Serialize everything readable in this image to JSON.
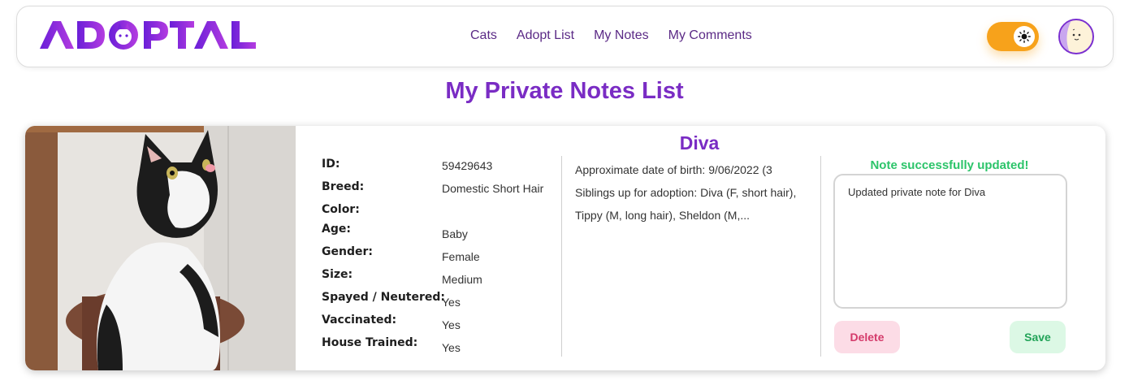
{
  "header": {
    "logo_text": "ADOPTAL",
    "nav": [
      "Cats",
      "Adopt List",
      "My Notes",
      "My Comments"
    ],
    "theme_toggle_icon": "sun-icon",
    "avatar_icon": "avatar-icon"
  },
  "page": {
    "title": "My Private Notes List"
  },
  "card": {
    "name": "Diva",
    "details": [
      {
        "label": "ID:",
        "value": "59429643"
      },
      {
        "label": "Breed:",
        "value": "Domestic Short Hair"
      },
      {
        "label": "Color:",
        "value": ""
      },
      {
        "label": "Age:",
        "value": "Baby"
      },
      {
        "label": "Gender:",
        "value": "Female"
      },
      {
        "label": "Size:",
        "value": "Medium"
      },
      {
        "label": "Spayed / Neutered:",
        "value": "Yes"
      },
      {
        "label": "Vaccinated:",
        "value": "Yes"
      },
      {
        "label": "House Trained:",
        "value": "Yes"
      }
    ],
    "description": "Approximate date of birth: 9/06/2022 (3 Siblings up for adoption: Diva (F, short hair), Tippy (M, long hair), Sheldon (M,...",
    "note_status": "Note successfully updated!",
    "note_text": "Updated private note for Diva",
    "delete_label": "Delete",
    "save_label": "Save"
  },
  "colors": {
    "accent": "#7a2cc4",
    "toggle": "#f7a21b",
    "success": "#2cc46a",
    "delete": "#d43a6a"
  }
}
